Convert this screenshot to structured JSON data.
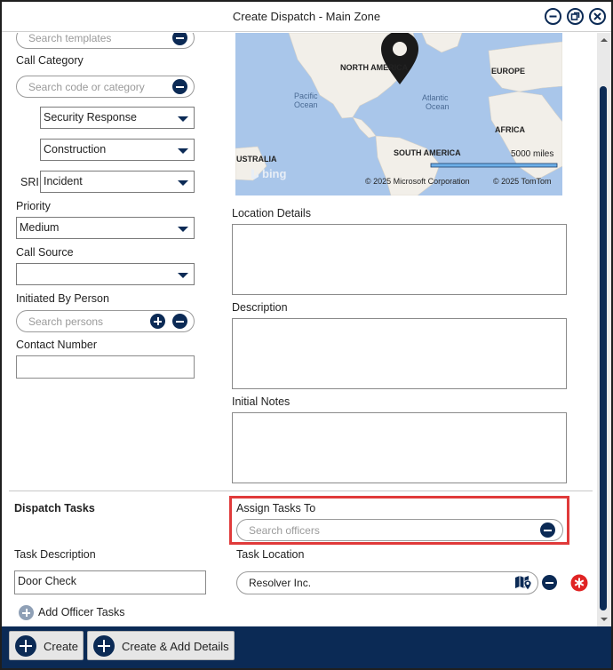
{
  "window": {
    "title": "Create Dispatch - Main Zone"
  },
  "left": {
    "templates_placeholder": "Search templates",
    "call_category_label": "Call Category",
    "category_placeholder": "Search code or category",
    "category_select_1": "Security Response",
    "category_select_2": "Construction",
    "sri_label": "SRI",
    "sri_value": "Incident",
    "priority_label": "Priority",
    "priority_value": "Medium",
    "call_source_label": "Call Source",
    "call_source_value": "",
    "initiated_by_label": "Initiated By Person",
    "persons_placeholder": "Search persons",
    "contact_label": "Contact Number",
    "contact_value": ""
  },
  "map": {
    "labels": {
      "north_america": "NORTH AMERICA",
      "europe": "EUROPE",
      "pacific": "Pacific",
      "ocean1": "Ocean",
      "atlantic": "Atlantic",
      "ocean2": "Ocean",
      "africa": "AFRICA",
      "south_america": "SOUTH AMERICA",
      "australia": "USTRALIA",
      "scale": "5000 miles",
      "bing": "bing",
      "copyright_ms": "© 2025 Microsoft Corporation",
      "copyright_tomtom": "© 2025 TomTom"
    }
  },
  "right": {
    "location_details_label": "Location Details",
    "description_label": "Description",
    "initial_notes_label": "Initial Notes"
  },
  "tasks": {
    "section_title": "Dispatch Tasks",
    "assign_label": "Assign Tasks To",
    "officers_placeholder": "Search officers",
    "task_description_label": "Task Description",
    "task_description_value": "Door Check",
    "task_location_label": "Task Location",
    "task_location_value": "Resolver Inc.",
    "add_officer_tasks": "Add Officer Tasks"
  },
  "footer": {
    "create": "Create",
    "create_add_details": "Create & Add Details"
  },
  "colors": {
    "accent": "#0b2a55",
    "highlight": "#e03a3a",
    "map_water": "#a9c6ea",
    "map_land": "#f2efe9"
  },
  "icons": [
    "minimize-icon",
    "restore-icon",
    "close-icon",
    "map-location-icon",
    "required-icon",
    "plus-icon",
    "minus-icon"
  ]
}
